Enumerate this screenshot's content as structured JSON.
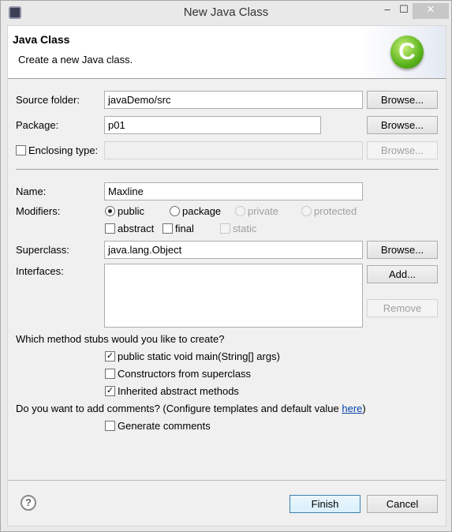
{
  "window": {
    "title": "New Java Class",
    "minimize": "–",
    "maximize": "☐",
    "close": "✕"
  },
  "header": {
    "title": "Java Class",
    "description": "Create a new Java class.",
    "logo": "C"
  },
  "form": {
    "source_folder": {
      "label": "Source folder:",
      "value": "javaDemo/src",
      "browse": "Browse..."
    },
    "package": {
      "label": "Package:",
      "value": "p01",
      "browse": "Browse..."
    },
    "enclosing": {
      "label": "Enclosing type:",
      "checked": false,
      "value": "",
      "browse": "Browse..."
    },
    "name": {
      "label": "Name:",
      "value": "Maxline"
    },
    "modifiers": {
      "label": "Modifiers:",
      "public": "public",
      "package": "package",
      "private": "private",
      "protected": "protected",
      "abstract": "abstract",
      "final": "final",
      "static": "static",
      "selected": "public"
    },
    "superclass": {
      "label": "Superclass:",
      "value": "java.lang.Object",
      "browse": "Browse..."
    },
    "interfaces": {
      "label": "Interfaces:",
      "add": "Add...",
      "remove": "Remove"
    },
    "stubs": {
      "question": "Which method stubs would you like to create?",
      "main": "public static void main(String[] args)",
      "main_checked": true,
      "constructors": "Constructors from superclass",
      "constructors_checked": false,
      "inherited": "Inherited abstract methods",
      "inherited_checked": true
    },
    "comments": {
      "question": "Do you want to add comments? (Configure templates and default value ",
      "link": "here",
      "close": ")",
      "generate": "Generate comments",
      "generate_checked": false
    }
  },
  "footer": {
    "help": "?",
    "finish": "Finish",
    "cancel": "Cancel"
  }
}
